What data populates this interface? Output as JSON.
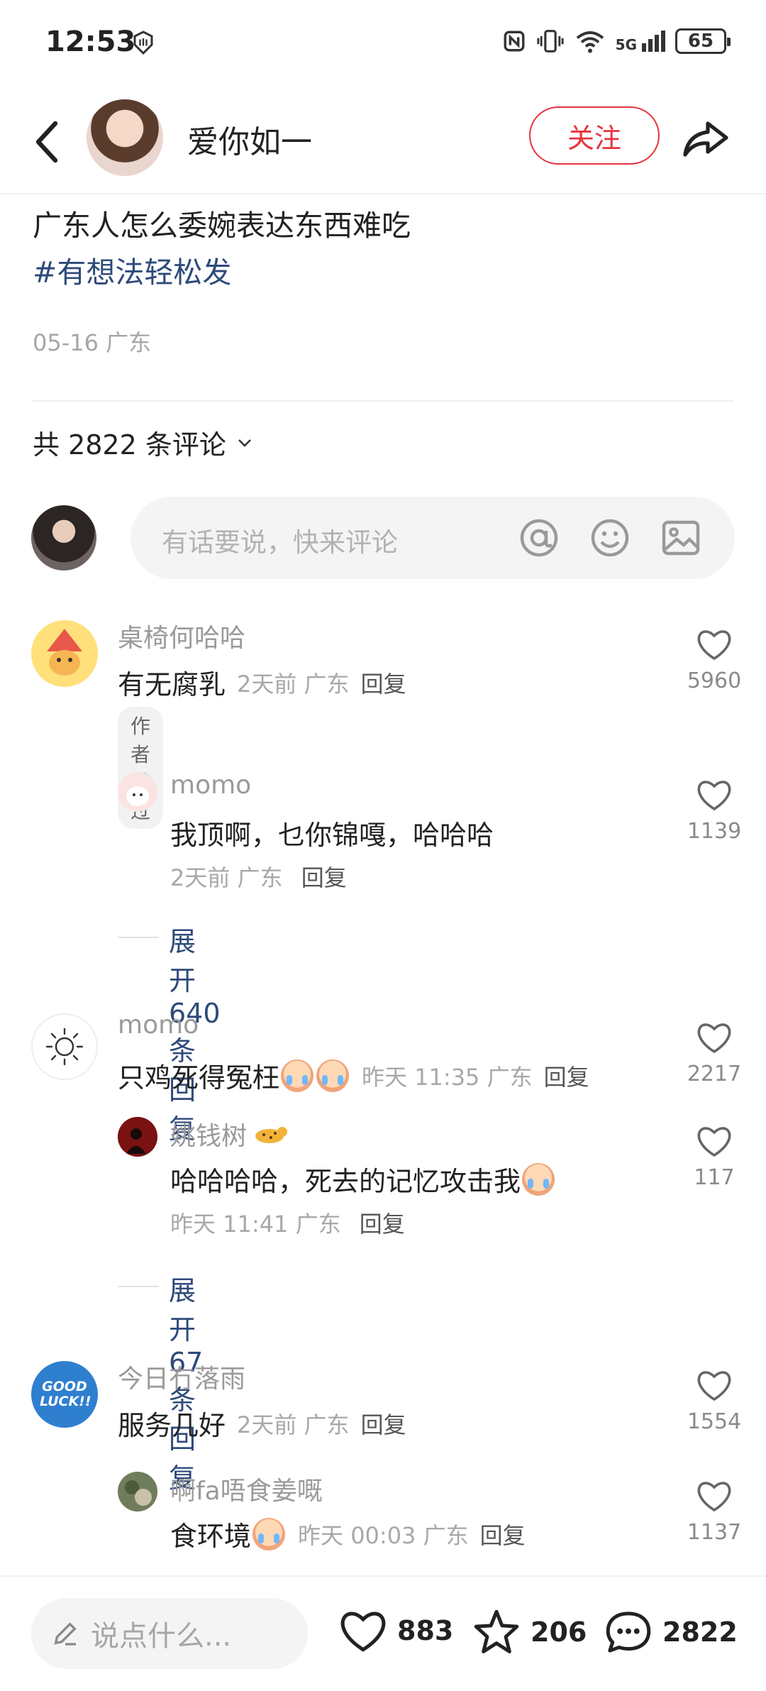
{
  "status_bar": {
    "time": "12:53",
    "network": "5G",
    "battery": "65"
  },
  "header": {
    "author_name": "爱你如一",
    "follow_label": "关注"
  },
  "post": {
    "text": "广东人怎么委婉表达东西难吃",
    "tag": "#有想法轻松发",
    "meta": "05-16 广东"
  },
  "comments_header": {
    "count_label": "共 2822 条评论"
  },
  "comment_input": {
    "placeholder": "有话要说，快来评论"
  },
  "comments": [
    {
      "name": "桌椅何哈哈",
      "text": "有无腐乳",
      "time": "2天前 广东",
      "reply": "回复",
      "likes": "5960",
      "badge": "作者赞过",
      "replies": [
        {
          "name": "momo",
          "text": "我顶啊，乜你锦嘎，哈哈哈",
          "meta": "2天前 广东",
          "reply": "回复",
          "likes": "1139"
        }
      ],
      "expand": "展开 640 条回复"
    },
    {
      "name": "momo",
      "text": "只鸡死得冤枉",
      "time": "昨天 11:35 广东",
      "reply": "回复",
      "likes": "2217",
      "replies": [
        {
          "name": "姚钱树",
          "text": "哈哈哈哈，死去的记忆攻击我",
          "meta": "昨天 11:41 广东",
          "reply": "回复",
          "likes": "117"
        }
      ],
      "expand": "展开 67 条回复"
    },
    {
      "name": "今日冇落雨",
      "text": "服务几好",
      "time": "2天前 广东",
      "reply": "回复",
      "likes": "1554",
      "avatar_text": "GOOD LUCK!!",
      "replies": [
        {
          "name": "啊fa唔食姜嘅",
          "text": "食环境",
          "meta": "昨天 00:03 广东",
          "reply": "回复",
          "likes": "1137"
        }
      ]
    }
  ],
  "bottom_bar": {
    "input_placeholder": "说点什么...",
    "likes": "883",
    "favorites": "206",
    "comments": "2822"
  },
  "colors": {
    "accent_red": "#e5343e",
    "link_blue": "#2e4a7a"
  }
}
